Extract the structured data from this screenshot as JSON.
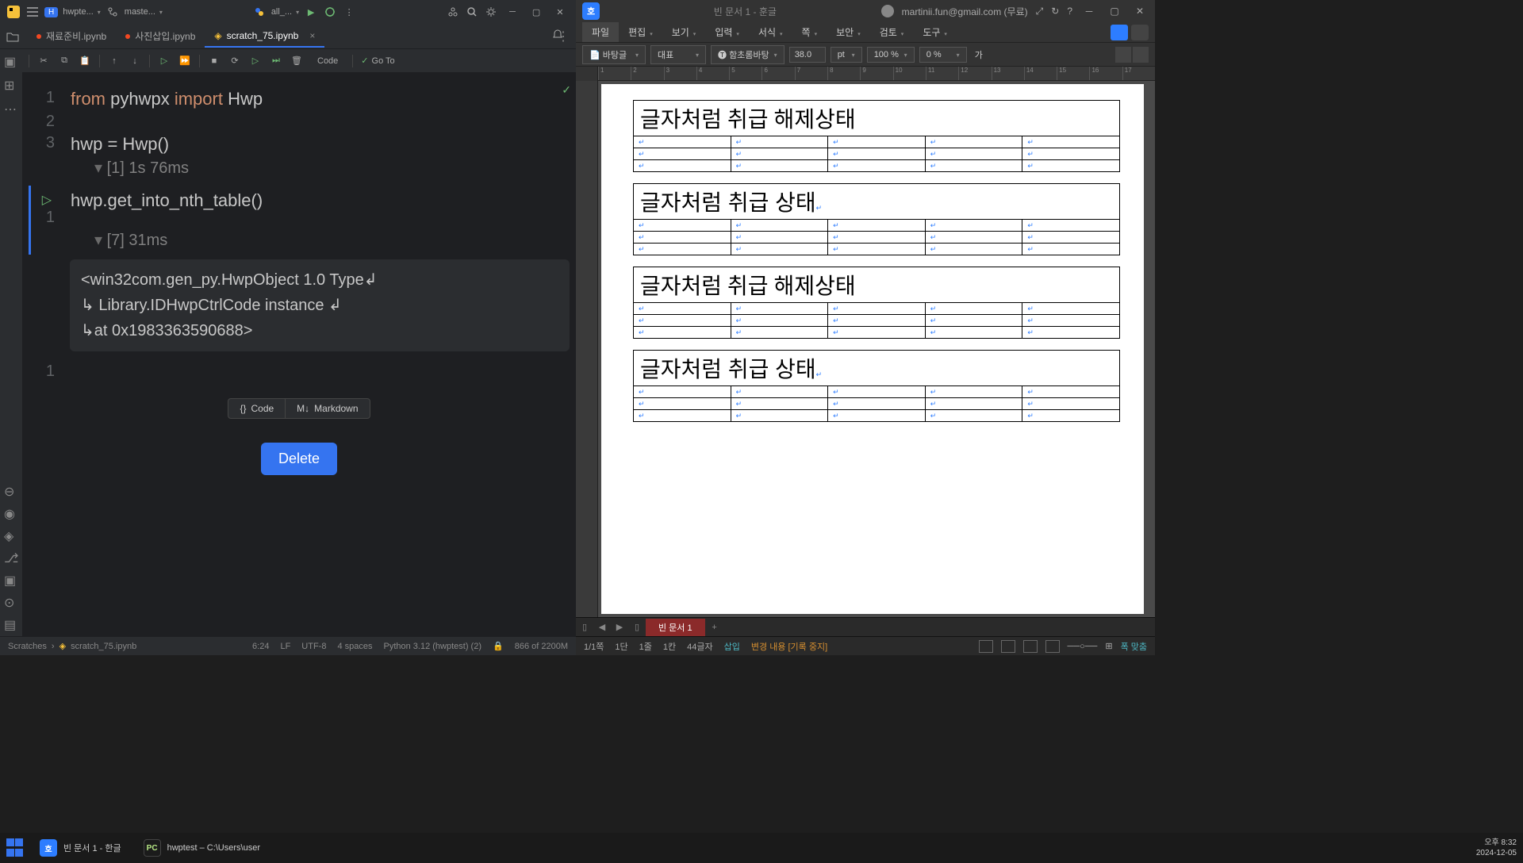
{
  "ide": {
    "project": "hwpte...",
    "branch": "maste...",
    "run_config": "all_...",
    "tabs": [
      {
        "name": "재료준비.ipynb",
        "color": "red"
      },
      {
        "name": "사진삽입.ipynb",
        "color": "red"
      },
      {
        "name": "scratch_75.ipynb",
        "active": true
      }
    ],
    "toolbar": {
      "code_dd": "Code",
      "goto": "Go To"
    },
    "code": {
      "cell1": {
        "line1_kw1": "from",
        "line1_mod": " pyhwpx ",
        "line1_kw2": "import",
        "line1_cls": " Hwp",
        "line3": "hwp = Hwp()",
        "status": "[1] 1s 76ms"
      },
      "cell2": {
        "line1": "hwp.get_into_nth_table()",
        "status": "[7] 31ms",
        "output_l1": "<win32com.gen_py.HwpObject 1.0 Type↲",
        "output_l2": "↳ Library.IDHwpCtrlCode instance ↲",
        "output_l3": "↳at 0x1983363590688>"
      }
    },
    "add_code": "Code",
    "add_md": "Markdown",
    "delete_btn": "Delete",
    "statusbar": {
      "crumbs1": "Scratches",
      "crumbs2": "scratch_75.ipynb",
      "pos": "6:24",
      "le": "LF",
      "enc": "UTF-8",
      "indent": "4 spaces",
      "python": "Python 3.12 (hwptest) (2)",
      "mem": "866 of 2200M"
    }
  },
  "hwp": {
    "title": "빈 문서 1 - 훈글",
    "user": "martinii.fun@gmail.com (무료)",
    "menus": [
      "파일",
      "편집",
      "보기",
      "입력",
      "서식",
      "쪽",
      "보안",
      "검토",
      "도구"
    ],
    "toolbar": {
      "style": "바탕글",
      "repr": "대표",
      "font": "함초롬바탕",
      "size": "38.0",
      "unit": "pt",
      "zoom": "100 %",
      "spacing": "0 %",
      "ga": "가"
    },
    "ruler": [
      "1",
      "2",
      "3",
      "4",
      "5",
      "6",
      "7",
      "8",
      "9",
      "10",
      "11",
      "12",
      "13",
      "14",
      "15",
      "16",
      "17"
    ],
    "tables": [
      "글자처럼 취급 해제상태",
      "글자처럼 취급 상태",
      "글자처럼 취급 해제상태",
      "글자처럼 취급 상태"
    ],
    "doc_tab": "빈 문서 1",
    "status": {
      "page": "1/1쪽",
      "dan": "1단",
      "jul": "1줄",
      "kan": "1칸",
      "char": "44글자",
      "mode": "삽입",
      "rec": "변경 내용 [기록 중지]",
      "fit": "폭 맞춤"
    }
  },
  "taskbar": {
    "task1": "빈 문서 1 - 한글",
    "task2": "hwptest – C:\\Users\\user",
    "time": "오후 8:32",
    "date": "2024-12-05"
  }
}
